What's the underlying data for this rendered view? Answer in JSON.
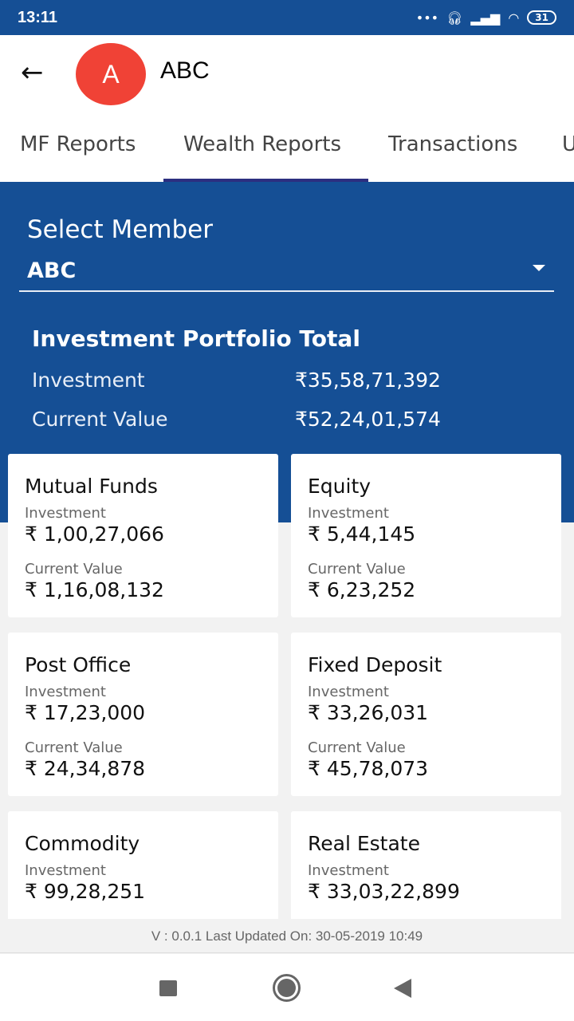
{
  "status_bar": {
    "time": "13:11",
    "battery": "31"
  },
  "header": {
    "avatar_letter": "A",
    "title": "ABC"
  },
  "tabs": [
    {
      "label": "MF Reports"
    },
    {
      "label": "Wealth Reports",
      "active": true
    },
    {
      "label": "Transactions"
    },
    {
      "label": "U"
    }
  ],
  "member": {
    "label": "Select Member",
    "value": "ABC"
  },
  "portfolio": {
    "title": "Investment Portfolio Total",
    "investment_label": "Investment",
    "investment": "₹35,58,71,392",
    "current_label": "Current Value",
    "current": "₹52,24,01,574"
  },
  "cards": [
    {
      "name": "Mutual Funds",
      "investment_label": "Investment",
      "investment": "₹ 1,00,27,066",
      "current_label": "Current Value",
      "current": "₹ 1,16,08,132"
    },
    {
      "name": "Equity",
      "investment_label": "Investment",
      "investment": "₹ 5,44,145",
      "current_label": "Current Value",
      "current": "₹ 6,23,252"
    },
    {
      "name": "Post Office",
      "investment_label": "Investment",
      "investment": "₹ 17,23,000",
      "current_label": "Current Value",
      "current": "₹ 24,34,878"
    },
    {
      "name": "Fixed Deposit",
      "investment_label": "Investment",
      "investment": "₹ 33,26,031",
      "current_label": "Current Value",
      "current": "₹ 45,78,073"
    },
    {
      "name": "Commodity",
      "investment_label": "Investment",
      "investment": "₹ 99,28,251"
    },
    {
      "name": "Real Estate",
      "investment_label": "Investment",
      "investment": "₹ 33,03,22,899"
    }
  ],
  "footer": {
    "text": "V : 0.0.1 Last Updated On: 30-05-2019 10:49"
  },
  "colors": {
    "primary": "#154f95",
    "avatar": "#f04236",
    "tab_indicator": "#2c2f80"
  }
}
